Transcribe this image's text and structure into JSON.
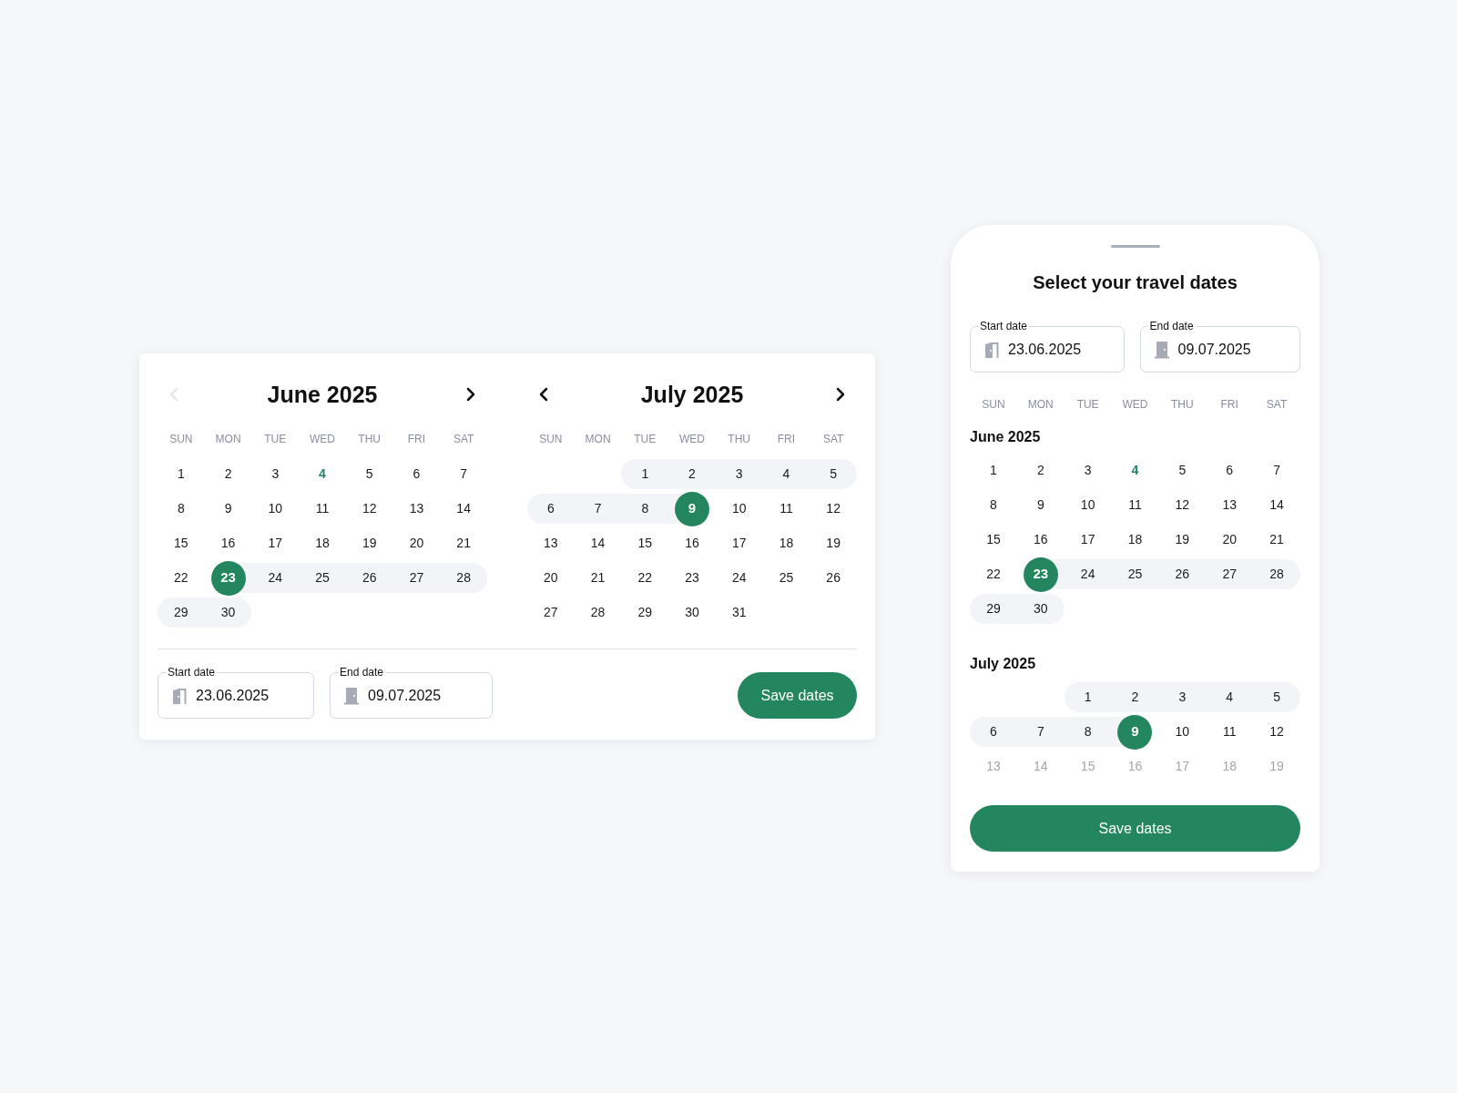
{
  "desktop_picker": {
    "months": [
      {
        "title": "June 2025",
        "prev_disabled": true,
        "next_disabled": false,
        "weekdays": [
          "SUN",
          "MON",
          "TUE",
          "WED",
          "THU",
          "FRI",
          "SAT"
        ],
        "weeks": [
          {
            "faded": false,
            "days": [
              {
                "label": "1",
                "selected": false,
                "in_range": false,
                "today": false
              },
              {
                "label": "2",
                "selected": false,
                "in_range": false,
                "today": false
              },
              {
                "label": "3",
                "selected": false,
                "in_range": false,
                "today": false
              },
              {
                "label": "4",
                "selected": false,
                "in_range": false,
                "today": true
              },
              {
                "label": "5",
                "selected": false,
                "in_range": false,
                "today": false
              },
              {
                "label": "6",
                "selected": false,
                "in_range": false,
                "today": false
              },
              {
                "label": "7",
                "selected": false,
                "in_range": false,
                "today": false
              }
            ]
          },
          {
            "faded": false,
            "days": [
              {
                "label": "8",
                "selected": false,
                "in_range": false,
                "today": false
              },
              {
                "label": "9",
                "selected": false,
                "in_range": false,
                "today": false
              },
              {
                "label": "10",
                "selected": false,
                "in_range": false,
                "today": false
              },
              {
                "label": "11",
                "selected": false,
                "in_range": false,
                "today": false
              },
              {
                "label": "12",
                "selected": false,
                "in_range": false,
                "today": false
              },
              {
                "label": "13",
                "selected": false,
                "in_range": false,
                "today": false
              },
              {
                "label": "14",
                "selected": false,
                "in_range": false,
                "today": false
              }
            ]
          },
          {
            "faded": false,
            "days": [
              {
                "label": "15",
                "selected": false,
                "in_range": false,
                "today": false
              },
              {
                "label": "16",
                "selected": false,
                "in_range": false,
                "today": false
              },
              {
                "label": "17",
                "selected": false,
                "in_range": false,
                "today": false
              },
              {
                "label": "18",
                "selected": false,
                "in_range": false,
                "today": false
              },
              {
                "label": "19",
                "selected": false,
                "in_range": false,
                "today": false
              },
              {
                "label": "20",
                "selected": false,
                "in_range": false,
                "today": false
              },
              {
                "label": "21",
                "selected": false,
                "in_range": false,
                "today": false
              }
            ]
          },
          {
            "faded": false,
            "days": [
              {
                "label": "22",
                "selected": false,
                "in_range": false,
                "today": false
              },
              {
                "label": "23",
                "selected": true,
                "in_range": false,
                "today": false
              },
              {
                "label": "24",
                "selected": false,
                "in_range": true,
                "today": false
              },
              {
                "label": "25",
                "selected": false,
                "in_range": true,
                "today": false
              },
              {
                "label": "26",
                "selected": false,
                "in_range": true,
                "today": false
              },
              {
                "label": "27",
                "selected": false,
                "in_range": true,
                "today": false
              },
              {
                "label": "28",
                "selected": false,
                "in_range": true,
                "today": false
              }
            ]
          },
          {
            "faded": false,
            "align_end": false,
            "days": [
              {
                "label": "29",
                "selected": false,
                "in_range": true,
                "today": false
              },
              {
                "label": "30",
                "selected": false,
                "in_range": true,
                "today": false
              }
            ]
          }
        ]
      },
      {
        "title": "July 2025",
        "prev_disabled": false,
        "next_disabled": false,
        "weekdays": [
          "SUN",
          "MON",
          "TUE",
          "WED",
          "THU",
          "FRI",
          "SAT"
        ],
        "weeks": [
          {
            "faded": false,
            "align_end": true,
            "days": [
              {
                "label": "1",
                "selected": false,
                "in_range": true,
                "today": false
              },
              {
                "label": "2",
                "selected": false,
                "in_range": true,
                "today": false
              },
              {
                "label": "3",
                "selected": false,
                "in_range": true,
                "today": false
              },
              {
                "label": "4",
                "selected": false,
                "in_range": true,
                "today": false
              },
              {
                "label": "5",
                "selected": false,
                "in_range": true,
                "today": false
              }
            ]
          },
          {
            "faded": false,
            "days": [
              {
                "label": "6",
                "selected": false,
                "in_range": true,
                "today": false
              },
              {
                "label": "7",
                "selected": false,
                "in_range": true,
                "today": false
              },
              {
                "label": "8",
                "selected": false,
                "in_range": true,
                "today": false
              },
              {
                "label": "9",
                "selected": true,
                "in_range": false,
                "today": false
              },
              {
                "label": "10",
                "selected": false,
                "in_range": false,
                "today": false
              },
              {
                "label": "11",
                "selected": false,
                "in_range": false,
                "today": false
              },
              {
                "label": "12",
                "selected": false,
                "in_range": false,
                "today": false
              }
            ]
          },
          {
            "faded": false,
            "days": [
              {
                "label": "13",
                "selected": false,
                "in_range": false,
                "today": false
              },
              {
                "label": "14",
                "selected": false,
                "in_range": false,
                "today": false
              },
              {
                "label": "15",
                "selected": false,
                "in_range": false,
                "today": false
              },
              {
                "label": "16",
                "selected": false,
                "in_range": false,
                "today": false
              },
              {
                "label": "17",
                "selected": false,
                "in_range": false,
                "today": false
              },
              {
                "label": "18",
                "selected": false,
                "in_range": false,
                "today": false
              },
              {
                "label": "19",
                "selected": false,
                "in_range": false,
                "today": false
              }
            ]
          },
          {
            "faded": false,
            "days": [
              {
                "label": "20",
                "selected": false,
                "in_range": false,
                "today": false
              },
              {
                "label": "21",
                "selected": false,
                "in_range": false,
                "today": false
              },
              {
                "label": "22",
                "selected": false,
                "in_range": false,
                "today": false
              },
              {
                "label": "23",
                "selected": false,
                "in_range": false,
                "today": false
              },
              {
                "label": "24",
                "selected": false,
                "in_range": false,
                "today": false
              },
              {
                "label": "25",
                "selected": false,
                "in_range": false,
                "today": false
              },
              {
                "label": "26",
                "selected": false,
                "in_range": false,
                "today": false
              }
            ]
          },
          {
            "faded": false,
            "align_end": false,
            "days": [
              {
                "label": "27",
                "selected": false,
                "in_range": false,
                "today": false
              },
              {
                "label": "28",
                "selected": false,
                "in_range": false,
                "today": false
              },
              {
                "label": "29",
                "selected": false,
                "in_range": false,
                "today": false
              },
              {
                "label": "30",
                "selected": false,
                "in_range": false,
                "today": false
              },
              {
                "label": "31",
                "selected": false,
                "in_range": false,
                "today": false
              }
            ]
          }
        ]
      }
    ],
    "fields": [
      {
        "kind": "start",
        "label": "Start date",
        "value": "23.06.2025"
      },
      {
        "kind": "end",
        "label": "End date",
        "value": "09.07.2025"
      }
    ],
    "save_button": "Save dates"
  },
  "mobile_sheet": {
    "title": "Select your travel dates",
    "fields": [
      {
        "kind": "start",
        "label": "Start date",
        "value": "23.06.2025"
      },
      {
        "kind": "end",
        "label": "End date",
        "value": "09.07.2025"
      }
    ],
    "weekdays": [
      "SUN",
      "MON",
      "TUE",
      "WED",
      "THU",
      "FRI",
      "SAT"
    ],
    "months": [
      {
        "title": "June 2025",
        "weeks": [
          {
            "faded": false,
            "days": [
              {
                "label": "1",
                "selected": false,
                "in_range": false,
                "today": false
              },
              {
                "label": "2",
                "selected": false,
                "in_range": false,
                "today": false
              },
              {
                "label": "3",
                "selected": false,
                "in_range": false,
                "today": false
              },
              {
                "label": "4",
                "selected": false,
                "in_range": false,
                "today": true
              },
              {
                "label": "5",
                "selected": false,
                "in_range": false,
                "today": false
              },
              {
                "label": "6",
                "selected": false,
                "in_range": false,
                "today": false
              },
              {
                "label": "7",
                "selected": false,
                "in_range": false,
                "today": false
              }
            ]
          },
          {
            "faded": false,
            "days": [
              {
                "label": "8",
                "selected": false,
                "in_range": false,
                "today": false
              },
              {
                "label": "9",
                "selected": false,
                "in_range": false,
                "today": false
              },
              {
                "label": "10",
                "selected": false,
                "in_range": false,
                "today": false
              },
              {
                "label": "11",
                "selected": false,
                "in_range": false,
                "today": false
              },
              {
                "label": "12",
                "selected": false,
                "in_range": false,
                "today": false
              },
              {
                "label": "13",
                "selected": false,
                "in_range": false,
                "today": false
              },
              {
                "label": "14",
                "selected": false,
                "in_range": false,
                "today": false
              }
            ]
          },
          {
            "faded": false,
            "days": [
              {
                "label": "15",
                "selected": false,
                "in_range": false,
                "today": false
              },
              {
                "label": "16",
                "selected": false,
                "in_range": false,
                "today": false
              },
              {
                "label": "17",
                "selected": false,
                "in_range": false,
                "today": false
              },
              {
                "label": "18",
                "selected": false,
                "in_range": false,
                "today": false
              },
              {
                "label": "19",
                "selected": false,
                "in_range": false,
                "today": false
              },
              {
                "label": "20",
                "selected": false,
                "in_range": false,
                "today": false
              },
              {
                "label": "21",
                "selected": false,
                "in_range": false,
                "today": false
              }
            ]
          },
          {
            "faded": false,
            "days": [
              {
                "label": "22",
                "selected": false,
                "in_range": false,
                "today": false
              },
              {
                "label": "23",
                "selected": true,
                "in_range": false,
                "today": false
              },
              {
                "label": "24",
                "selected": false,
                "in_range": true,
                "today": false
              },
              {
                "label": "25",
                "selected": false,
                "in_range": true,
                "today": false
              },
              {
                "label": "26",
                "selected": false,
                "in_range": true,
                "today": false
              },
              {
                "label": "27",
                "selected": false,
                "in_range": true,
                "today": false
              },
              {
                "label": "28",
                "selected": false,
                "in_range": true,
                "today": false
              }
            ]
          },
          {
            "faded": false,
            "align_end": false,
            "days": [
              {
                "label": "29",
                "selected": false,
                "in_range": true,
                "today": false
              },
              {
                "label": "30",
                "selected": false,
                "in_range": true,
                "today": false
              }
            ]
          }
        ]
      },
      {
        "title": "July 2025",
        "weeks": [
          {
            "faded": false,
            "align_end": true,
            "days": [
              {
                "label": "1",
                "selected": false,
                "in_range": true,
                "today": false
              },
              {
                "label": "2",
                "selected": false,
                "in_range": true,
                "today": false
              },
              {
                "label": "3",
                "selected": false,
                "in_range": true,
                "today": false
              },
              {
                "label": "4",
                "selected": false,
                "in_range": true,
                "today": false
              },
              {
                "label": "5",
                "selected": false,
                "in_range": true,
                "today": false
              }
            ]
          },
          {
            "faded": false,
            "days": [
              {
                "label": "6",
                "selected": false,
                "in_range": true,
                "today": false
              },
              {
                "label": "7",
                "selected": false,
                "in_range": true,
                "today": false
              },
              {
                "label": "8",
                "selected": false,
                "in_range": true,
                "today": false
              },
              {
                "label": "9",
                "selected": true,
                "in_range": false,
                "today": false
              },
              {
                "label": "10",
                "selected": false,
                "in_range": false,
                "today": false
              },
              {
                "label": "11",
                "selected": false,
                "in_range": false,
                "today": false
              },
              {
                "label": "12",
                "selected": false,
                "in_range": false,
                "today": false
              }
            ]
          },
          {
            "faded": true,
            "days": [
              {
                "label": "13",
                "selected": false,
                "in_range": false,
                "today": false
              },
              {
                "label": "14",
                "selected": false,
                "in_range": false,
                "today": false
              },
              {
                "label": "15",
                "selected": false,
                "in_range": false,
                "today": false
              },
              {
                "label": "16",
                "selected": false,
                "in_range": false,
                "today": false
              },
              {
                "label": "17",
                "selected": false,
                "in_range": false,
                "today": false
              },
              {
                "label": "18",
                "selected": false,
                "in_range": false,
                "today": false
              },
              {
                "label": "19",
                "selected": false,
                "in_range": false,
                "today": false
              }
            ]
          }
        ]
      }
    ],
    "save_button": "Save dates"
  }
}
